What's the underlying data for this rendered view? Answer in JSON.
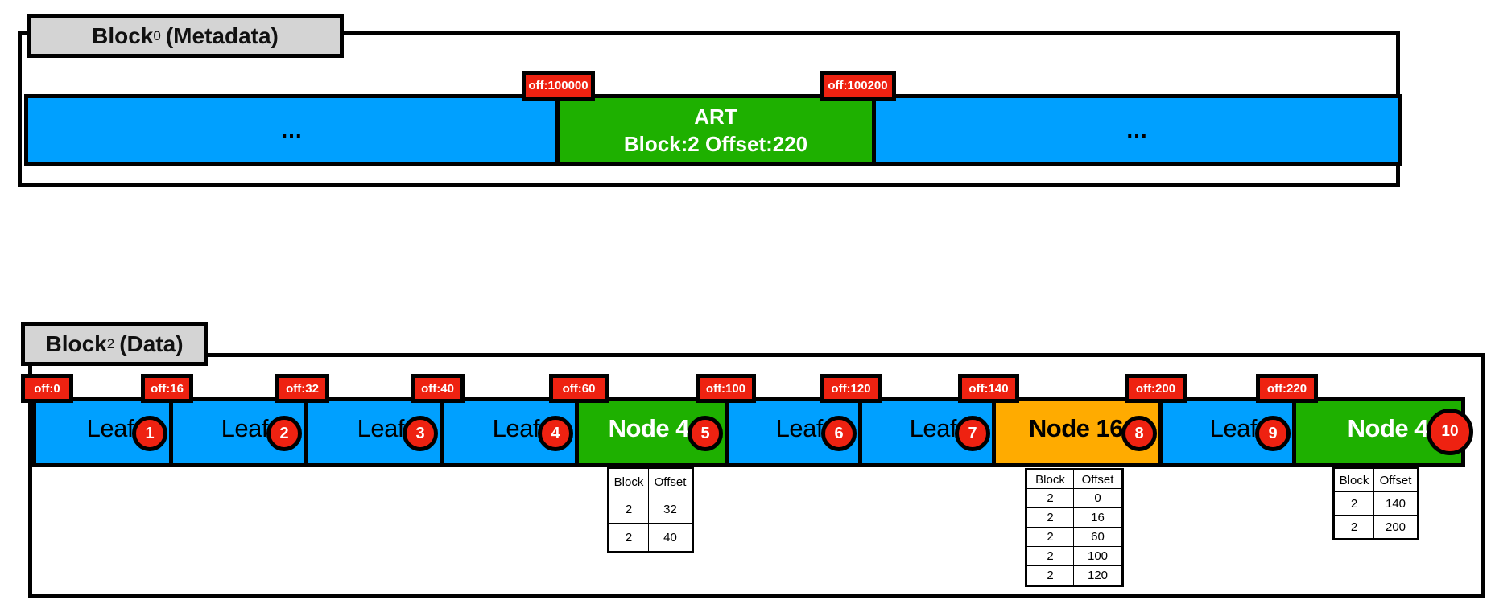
{
  "blocks": {
    "meta": {
      "title_main": "Block",
      "title_sub": "0",
      "title_suffix": "(Metadata)",
      "segments": [
        {
          "label": "...",
          "type": "filler",
          "color": "#00a0ff"
        },
        {
          "label_line1": "ART",
          "label_line2": "Block:2 Offset:220",
          "type": "art",
          "color": "#1eb000"
        },
        {
          "label": "...",
          "type": "filler",
          "color": "#00a0ff"
        }
      ],
      "offsets": [
        "off:100000",
        "off:100200"
      ]
    },
    "data": {
      "title_main": "Block",
      "title_sub": "2",
      "title_suffix": "(Data)",
      "offsets": [
        "off:0",
        "off:16",
        "off:32",
        "off:40",
        "off:60",
        "off:100",
        "off:120",
        "off:140",
        "off:200",
        "off:220"
      ],
      "segments": [
        {
          "label": "Leaf",
          "badge": "1",
          "kind": "leaf",
          "color": "#00a0ff"
        },
        {
          "label": "Leaf",
          "badge": "2",
          "kind": "leaf",
          "color": "#00a0ff"
        },
        {
          "label": "Leaf",
          "badge": "3",
          "kind": "leaf",
          "color": "#00a0ff"
        },
        {
          "label": "Leaf",
          "badge": "4",
          "kind": "leaf",
          "color": "#00a0ff"
        },
        {
          "label": "Node 4",
          "badge": "5",
          "kind": "node4",
          "color": "#1eb000"
        },
        {
          "label": "Leaf",
          "badge": "6",
          "kind": "leaf",
          "color": "#00a0ff"
        },
        {
          "label": "Leaf",
          "badge": "7",
          "kind": "leaf",
          "color": "#00a0ff"
        },
        {
          "label": "Node 16",
          "badge": "8",
          "kind": "node16",
          "color": "#ffab00"
        },
        {
          "label": "Leaf",
          "badge": "9",
          "kind": "leaf",
          "color": "#00a0ff"
        },
        {
          "label": "Node 4",
          "badge": "10",
          "kind": "node4",
          "color": "#1eb000"
        }
      ],
      "tables": [
        {
          "for_badge": "5",
          "headers": [
            "Block",
            "Offset"
          ],
          "rows": [
            [
              "2",
              "32"
            ],
            [
              "2",
              "40"
            ]
          ]
        },
        {
          "for_badge": "8",
          "headers": [
            "Block",
            "Offset"
          ],
          "rows": [
            [
              "2",
              "0"
            ],
            [
              "2",
              "16"
            ],
            [
              "2",
              "60"
            ],
            [
              "2",
              "100"
            ],
            [
              "2",
              "120"
            ]
          ]
        },
        {
          "for_badge": "10",
          "headers": [
            "Block",
            "Offset"
          ],
          "rows": [
            [
              "2",
              "140"
            ],
            [
              "2",
              "200"
            ]
          ]
        }
      ]
    }
  },
  "colors": {
    "leaf": "#00a0ff",
    "node4": "#1eb000",
    "node16": "#ffab00",
    "offset_tag": "#ee2211",
    "title_tab": "#d4d4d4"
  }
}
